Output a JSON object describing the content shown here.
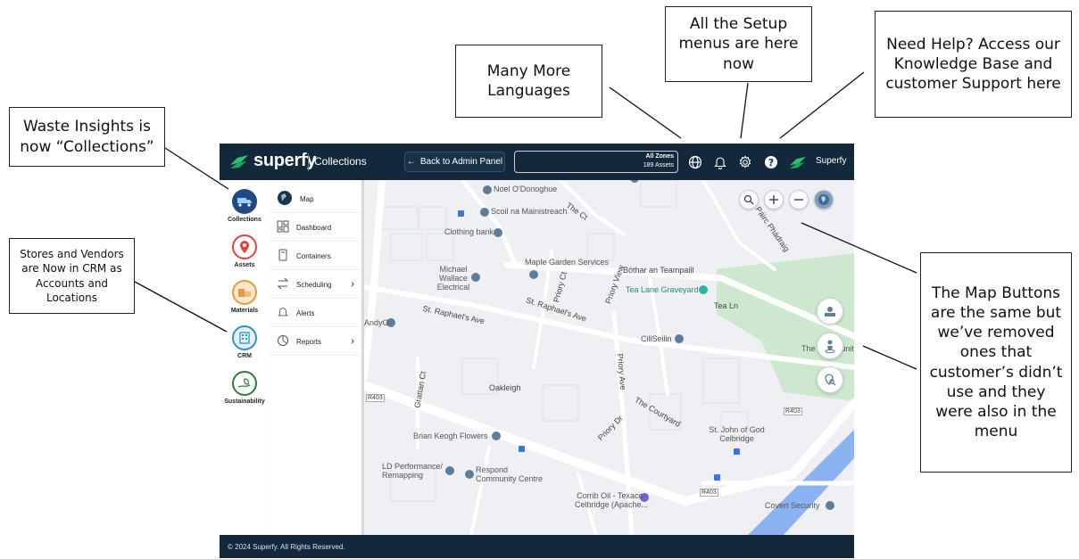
{
  "callouts": {
    "collections": "Waste Insights is now “Collections”",
    "crm": "Stores and Vendors are Now in CRM as Accounts and Locations",
    "languages": "Many More Languages",
    "setup": "All the Setup menus are here now",
    "help": "Need Help? Access our Knowledge Base and customer Support here",
    "map_buttons": "The Map Buttons are the same but we’ve removed ones that customer’s didn’t use and they were also in the menu"
  },
  "header": {
    "brand": "superfy",
    "module": "Collections",
    "back_button": "Back to Admin Panel",
    "zone_title": "All Zones",
    "zone_count": "189 Assets",
    "user_name": "Superfy"
  },
  "rail": {
    "items": [
      {
        "label": "Collections",
        "icon": "truck-icon",
        "color": "#1f4a86"
      },
      {
        "label": "Assets",
        "icon": "map-pin-icon",
        "color": "#e3443a"
      },
      {
        "label": "Materials",
        "icon": "materials-icon",
        "color": "#e89a3a"
      },
      {
        "label": "CRM",
        "icon": "building-icon",
        "color": "#2f8fd0"
      },
      {
        "label": "Sustainability",
        "icon": "leaf-hand-icon",
        "color": "#2e7d3a"
      }
    ]
  },
  "menu": {
    "items": [
      {
        "label": "Map",
        "icon": "globe-icon"
      },
      {
        "label": "Dashboard",
        "icon": "dashboard-icon"
      },
      {
        "label": "Containers",
        "icon": "container-icon"
      },
      {
        "label": "Scheduling",
        "icon": "swap-arrows-icon",
        "chevron": "›"
      },
      {
        "label": "Alerts",
        "icon": "bell-icon"
      },
      {
        "label": "Reports",
        "icon": "report-icon",
        "chevron": "›"
      }
    ]
  },
  "map": {
    "places": [
      "Noel O'Donoghue",
      "Scoil na Mainistreach",
      "Clothing bank",
      "Maple Garden Services",
      "Michael Wallace Electrical",
      "Tea Lane Graveyard",
      "AndyG",
      "CillSeilin",
      "Oakleigh",
      "St. John of God Celbridge",
      "Brian Keogh Flowers",
      "LD Performance/ Remapping",
      "Respond Community Centre",
      "Corrib Oil - Texaco - Celbridge (Apache...",
      "Covert Security",
      "The Community C"
    ],
    "streets": [
      "Bóthar an Teampaill",
      "Tea Ln",
      "St. Raphael's Ave",
      "St. Raphael's Ave",
      "Priory Ct",
      "Priory View",
      "Priory Ave",
      "Priory Dr",
      "The Courtyard",
      "Grattan Ct",
      "Páirc Phádraig",
      "The Ct",
      "R403",
      "R403",
      "R403"
    ]
  },
  "footer": {
    "copyright": "© 2024 Superfy. All Rights Reserved."
  },
  "colors": {
    "header_bg": "#13283b",
    "brand_green": "#29c46b",
    "map_bg": "#eef0f3",
    "road": "#ffffff",
    "park": "#cde8cf",
    "river": "#8bb3f2",
    "poi_blue": "#5f7d97"
  }
}
